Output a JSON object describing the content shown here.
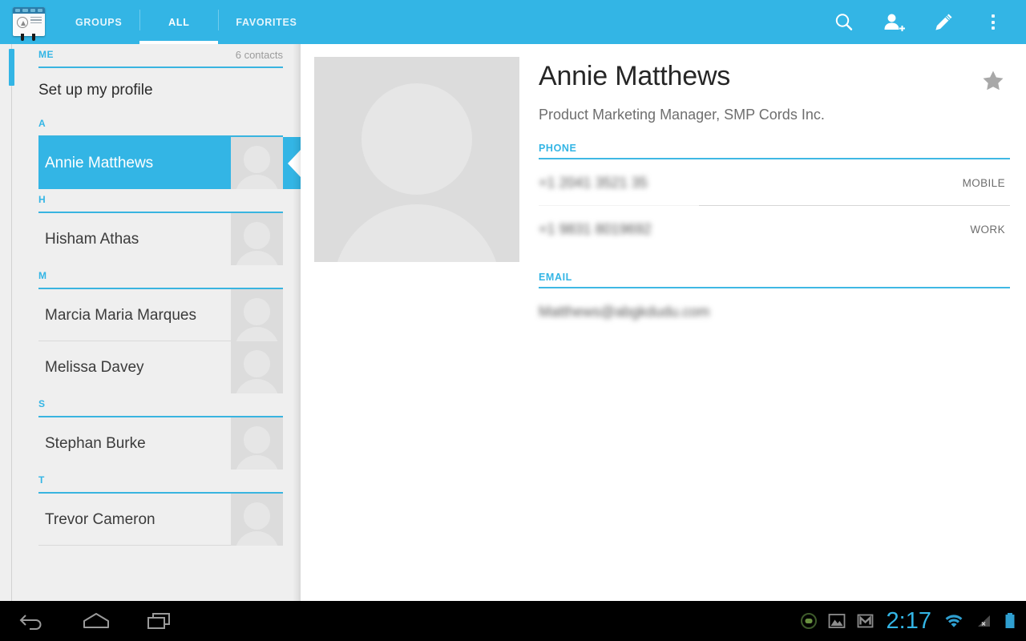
{
  "app": {
    "icon_name": "contacts-app-icon"
  },
  "tabs": [
    {
      "label": "GROUPS",
      "selected": false
    },
    {
      "label": "ALL",
      "selected": true
    },
    {
      "label": "FAVORITES",
      "selected": false
    }
  ],
  "action_bar": {
    "search_label": "search-icon",
    "add_contact_label": "add-contact-icon",
    "edit_label": "edit-pencil-icon",
    "overflow_label": "overflow-menu-icon"
  },
  "list": {
    "me_header": "ME",
    "contacts_count": "6 contacts",
    "profile_label": "Set up my profile",
    "sections": [
      {
        "letter": "A",
        "contacts": [
          {
            "name": "Annie Matthews",
            "selected": true,
            "divider": false
          }
        ]
      },
      {
        "letter": "H",
        "contacts": [
          {
            "name": "Hisham Athas",
            "selected": false,
            "divider": false
          }
        ]
      },
      {
        "letter": "M",
        "contacts": [
          {
            "name": "Marcia Maria Marques",
            "selected": false,
            "divider": true
          },
          {
            "name": "Melissa Davey",
            "selected": false,
            "divider": false
          }
        ]
      },
      {
        "letter": "S",
        "contacts": [
          {
            "name": "Stephan Burke",
            "selected": false,
            "divider": false
          }
        ]
      },
      {
        "letter": "T",
        "contacts": [
          {
            "name": "Trevor Cameron",
            "selected": false,
            "divider": true
          }
        ]
      }
    ]
  },
  "detail": {
    "name": "Annie Matthews",
    "title": "Product Marketing Manager, SMP Cords Inc.",
    "favorite_starred": false,
    "phone_section_label": "PHONE",
    "phones": [
      {
        "value": "+1 2041 3521 35",
        "type": "MOBILE"
      },
      {
        "value": "+1 9831 8019692",
        "type": "WORK"
      }
    ],
    "email_section_label": "EMAIL",
    "emails": [
      {
        "value": "Matthews@abgkdudu.com",
        "type": ""
      }
    ]
  },
  "system_bar": {
    "back_label": "back-button",
    "home_label": "home-button",
    "recents_label": "recent-apps-button",
    "time": "2:17",
    "notifications": [
      "message-icon",
      "gallery-image-icon",
      "gmail-icon"
    ],
    "status": [
      "wifi-icon",
      "no-sim-signal-icon",
      "battery-icon"
    ]
  },
  "colors": {
    "accent": "#33B5E5",
    "list_bg": "#EFEFEF",
    "detail_bg": "#FFFFFF",
    "nav_bg": "#000000",
    "clock": "#33B5E5"
  }
}
